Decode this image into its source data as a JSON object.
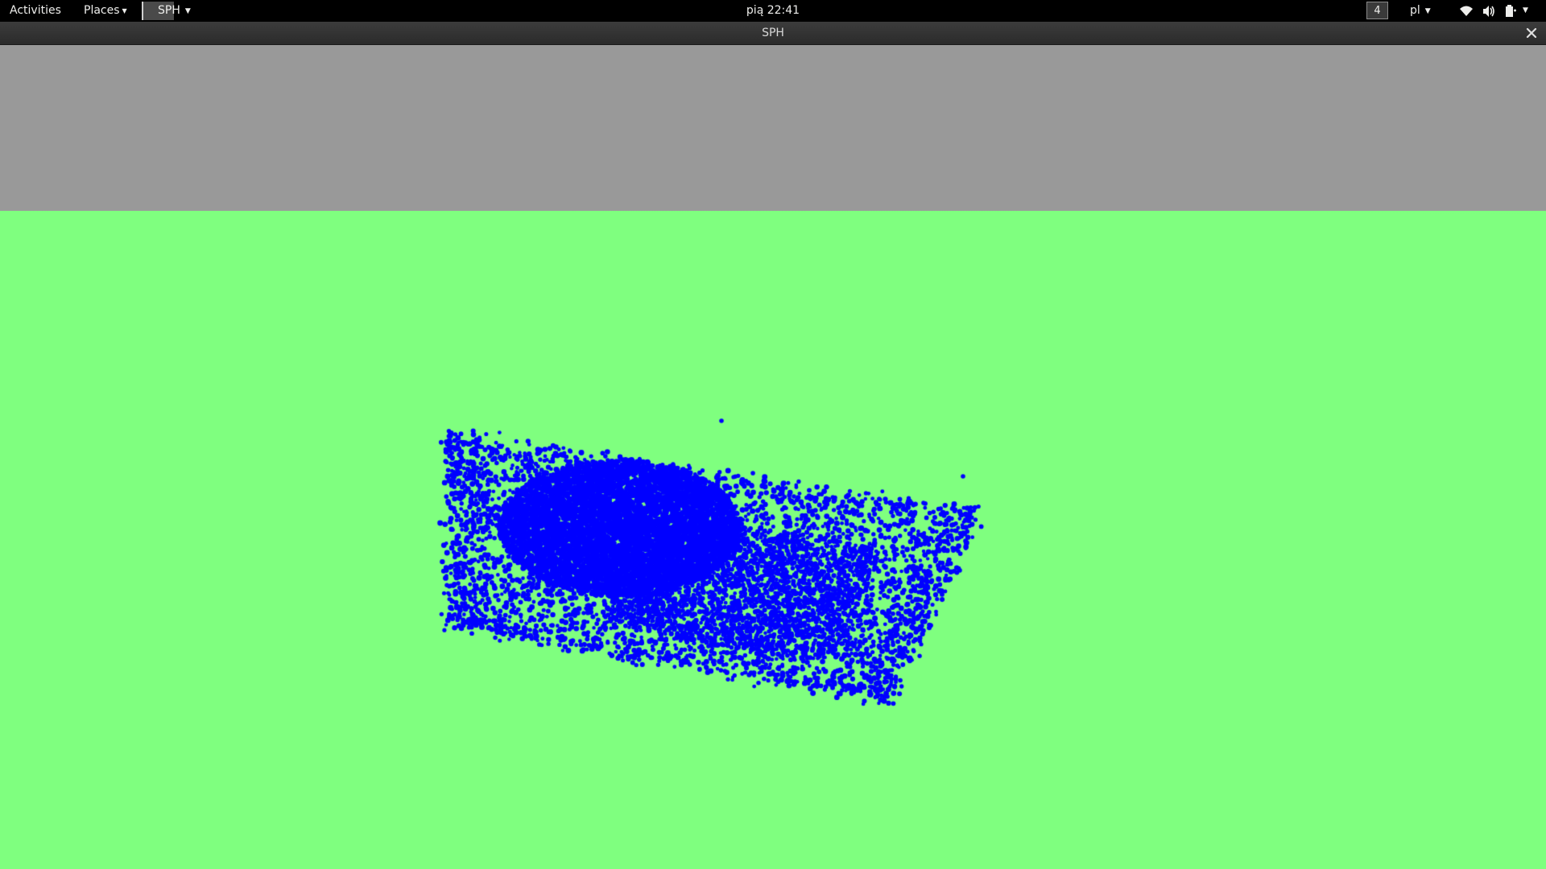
{
  "topbar": {
    "activities_label": "Activities",
    "places_label": "Places",
    "app_menu_label": "SPH",
    "clock": "pią 22:41",
    "workspace_number": "4",
    "keyboard_layout": "pl"
  },
  "window": {
    "title": "SPH",
    "close_glyph": "×"
  },
  "scene": {
    "sky_color": "#999999",
    "ground_color": "#7fff7f",
    "particle_color": "#0000ff"
  },
  "icons": {
    "wifi": "wifi-icon",
    "volume": "volume-icon",
    "power": "power-icon",
    "close": "close-icon",
    "dropdown": "chevron-down-icon"
  }
}
